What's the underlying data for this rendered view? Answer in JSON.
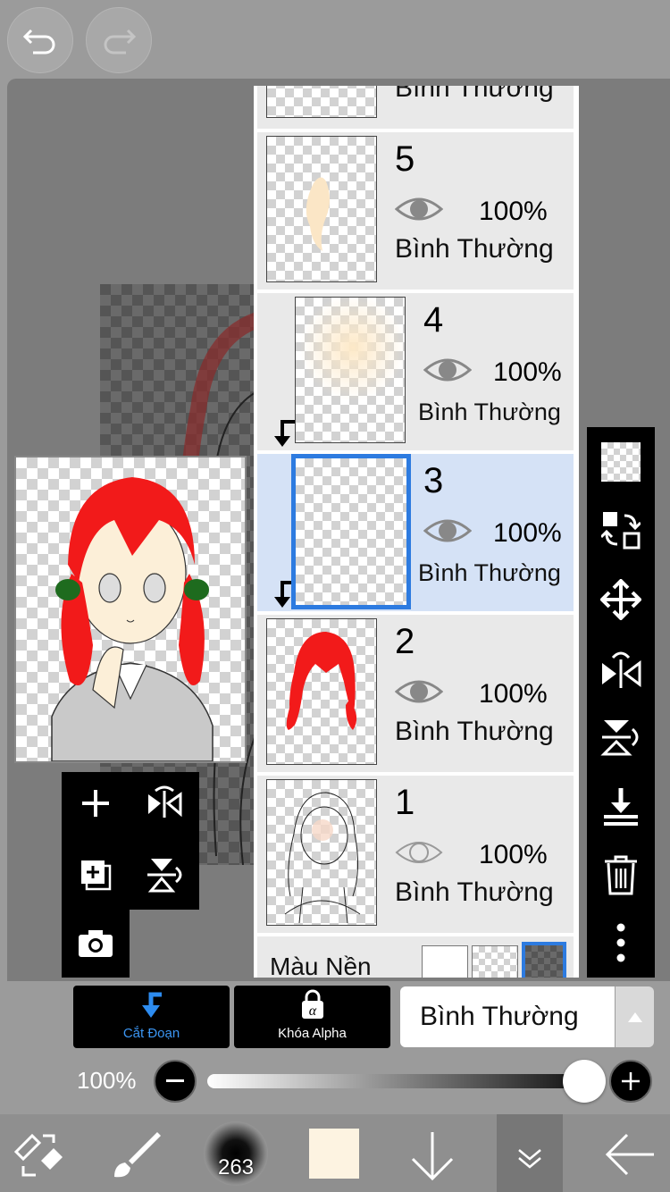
{
  "layers": [
    {
      "num": "",
      "opacity": "",
      "mode": "Bình Thường",
      "partial": true
    },
    {
      "num": "5",
      "opacity": "100%",
      "mode": "Bình Thường"
    },
    {
      "num": "4",
      "opacity": "100%",
      "mode": "Bình Thường",
      "clipped": true
    },
    {
      "num": "3",
      "opacity": "100%",
      "mode": "Bình Thường",
      "clipped": true,
      "selected": true
    },
    {
      "num": "2",
      "opacity": "100%",
      "mode": "Bình Thường"
    },
    {
      "num": "1",
      "opacity": "100%",
      "mode": "Bình Thường",
      "hidden_eye": true
    }
  ],
  "background_label": "Màu Nền",
  "buttons": {
    "clipping": "Cắt Đoạn",
    "alpha_lock": "Khóa Alpha",
    "blend_mode": "Bình Thường"
  },
  "opacity_slider": {
    "label": "100%",
    "value": 1.0
  },
  "brush_size": "263",
  "colors": {
    "accent": "#2d7be0",
    "current_color": "#fdf3e1",
    "selected_layer_bg": "#d5e2f6"
  }
}
